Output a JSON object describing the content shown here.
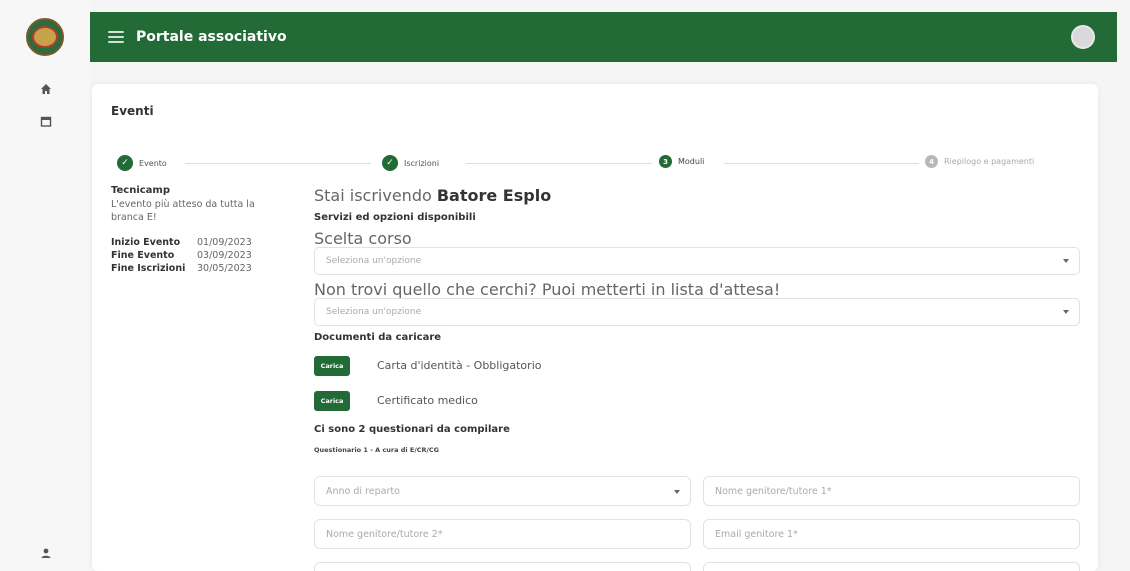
{
  "app": {
    "title": "Portale associativo"
  },
  "rail": {
    "icons": [
      "home-icon",
      "calendar-icon",
      "user-icon"
    ]
  },
  "page": {
    "title": "Eventi"
  },
  "stepper": [
    {
      "label": "Evento",
      "state": "done"
    },
    {
      "label": "Iscrizioni",
      "state": "done"
    },
    {
      "label": "Moduli",
      "state": "active",
      "number": "3"
    },
    {
      "label": "Riepilogo e pagamenti",
      "state": "pending",
      "number": "4"
    }
  ],
  "event": {
    "name": "Tecnicamp",
    "description": "L'evento più atteso da tutta la branca E!",
    "dates": [
      {
        "label": "Inizio Evento",
        "value": "01/09/2023"
      },
      {
        "label": "Fine Evento",
        "value": "03/09/2023"
      },
      {
        "label": "Fine Iscrizioni",
        "value": "30/05/2023"
      }
    ]
  },
  "form": {
    "subscribing_prefix": "Stai iscrivendo",
    "subscribing_name": "Batore Esplo",
    "services_title": "Servizi ed opzioni disponibili",
    "course_label": "Scelta corso",
    "course_placeholder": "Seleziona un'opzione",
    "waitlist_label": "Non trovi quello che cerchi? Puoi metterti in lista d'attesa!",
    "waitlist_placeholder": "Seleziona un'opzione",
    "documents_title": "Documenti da caricare",
    "documents": [
      {
        "button": "Carica",
        "label": "Carta d'identità - Obbligatorio"
      },
      {
        "button": "Carica",
        "label": "Certificato medico"
      }
    ],
    "questionnaires_title": "Ci sono 2 questionari da compilare",
    "questionnaire_1_title": "Questionario 1 - A cura di E/CR/CG",
    "fields": {
      "anno_reparto": "Anno di reparto",
      "nome_genitore_1": "Nome genitore/tutore 1*",
      "nome_genitore_2": "Nome genitore/tutore 2*",
      "email_genitore_1": "Email genitore 1*"
    }
  }
}
